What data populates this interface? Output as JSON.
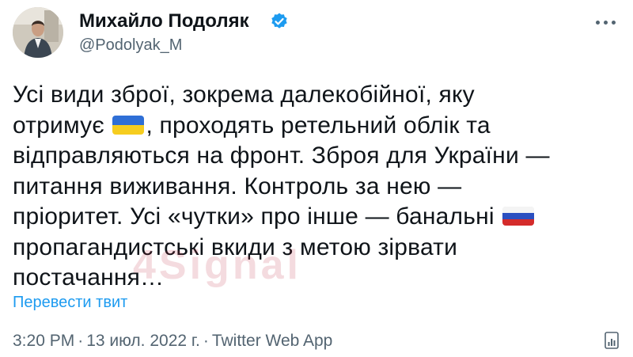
{
  "author": {
    "name": "Михайло Подоляк",
    "handle": "@Podolyak_M",
    "verified": true,
    "avatar_icon": "profile-photo"
  },
  "menu": {
    "icon": "more-horizontal-icon"
  },
  "tweet": {
    "lines": [
      "Усі види зброї, зокрема далекобійної, яку",
      "отримує",
      ", проходять ретельний облік та",
      "відправляються на фронт. Зброя для України —",
      "питання виживання. Контроль за нею —",
      "пріоритет. Усі «чутки» про інше — банальні",
      "пропагандистські вкиди з метою зірвати",
      "постачання…"
    ],
    "emoji": {
      "ukraine_flag": "flag-ukraine",
      "russia_flag": "flag-russia"
    }
  },
  "watermark": {
    "text": "4Signal",
    "color": "#c0283d"
  },
  "translate_label": "Перевести твит",
  "meta": {
    "time": "3:20 PM",
    "separator": "·",
    "date": "13 июл. 2022 г.",
    "source": "Twitter Web App"
  },
  "colors": {
    "text": "#0f1419",
    "secondary": "#536471",
    "link": "#1d9bf0",
    "verified": "#1d9bf0"
  }
}
